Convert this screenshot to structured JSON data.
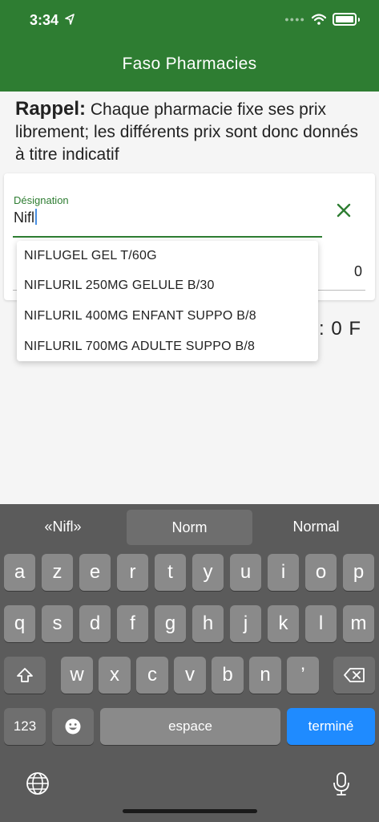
{
  "status": {
    "time": "3:34"
  },
  "app": {
    "title": "Faso Pharmacies"
  },
  "reminder": {
    "label": "Rappel:",
    "text": " Chaque pharmacie fixe ses prix librement; les différents prix sont donc donnés à titre indicatif"
  },
  "form": {
    "designation_label": "Désignation",
    "designation_value": "Nifl",
    "quantity_value": "0"
  },
  "total": ": 0 F",
  "suggestions": [
    "NIFLUGEL GEL T/60G",
    "NIFLURIL 250MG GELULE B/30",
    "NIFLURIL 400MG ENFANT SUPPO B/8",
    "NIFLURIL 700MG ADULTE SUPPO B/8"
  ],
  "keyboard": {
    "predictions": [
      "«Nifl»",
      "Norm",
      "Normal"
    ],
    "row1": [
      "a",
      "z",
      "e",
      "r",
      "t",
      "y",
      "u",
      "i",
      "o",
      "p"
    ],
    "row2": [
      "q",
      "s",
      "d",
      "f",
      "g",
      "h",
      "j",
      "k",
      "l",
      "m"
    ],
    "row3": [
      "w",
      "x",
      "c",
      "v",
      "b",
      "n",
      "’"
    ],
    "numbers_key": "123",
    "space_key": "espace",
    "done_key": "terminé"
  },
  "colors": {
    "primary": "#2e7d32",
    "done_key": "#1f8bff"
  }
}
